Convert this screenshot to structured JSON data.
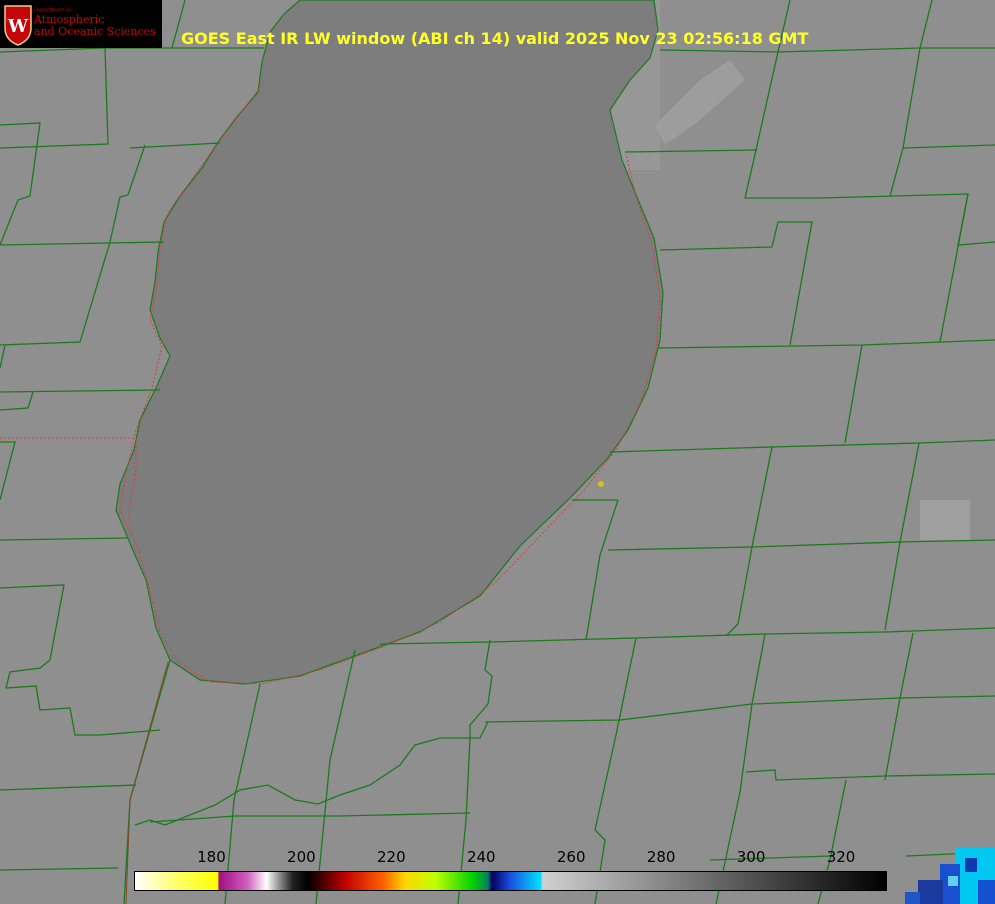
{
  "logo": {
    "dept_line": "Department of",
    "line1": "Atmospheric",
    "line2": "and Oceanic Sciences",
    "shield_letter": "W"
  },
  "title": "GOES East IR LW window (ABI ch 14) valid 2025 Nov 23 02:56:18 GMT",
  "colorbar": {
    "ticks": [
      "180",
      "200",
      "220",
      "240",
      "260",
      "280",
      "300",
      "320"
    ],
    "range": [
      163,
      330
    ]
  },
  "colors": {
    "land": "#8f8f8f",
    "lake": "#7d7d7d",
    "county_lines": "#1c7a1c",
    "coastline_dotted": "#e0393e",
    "title_text": "#ffff2a",
    "marker": "#d8c21a"
  }
}
